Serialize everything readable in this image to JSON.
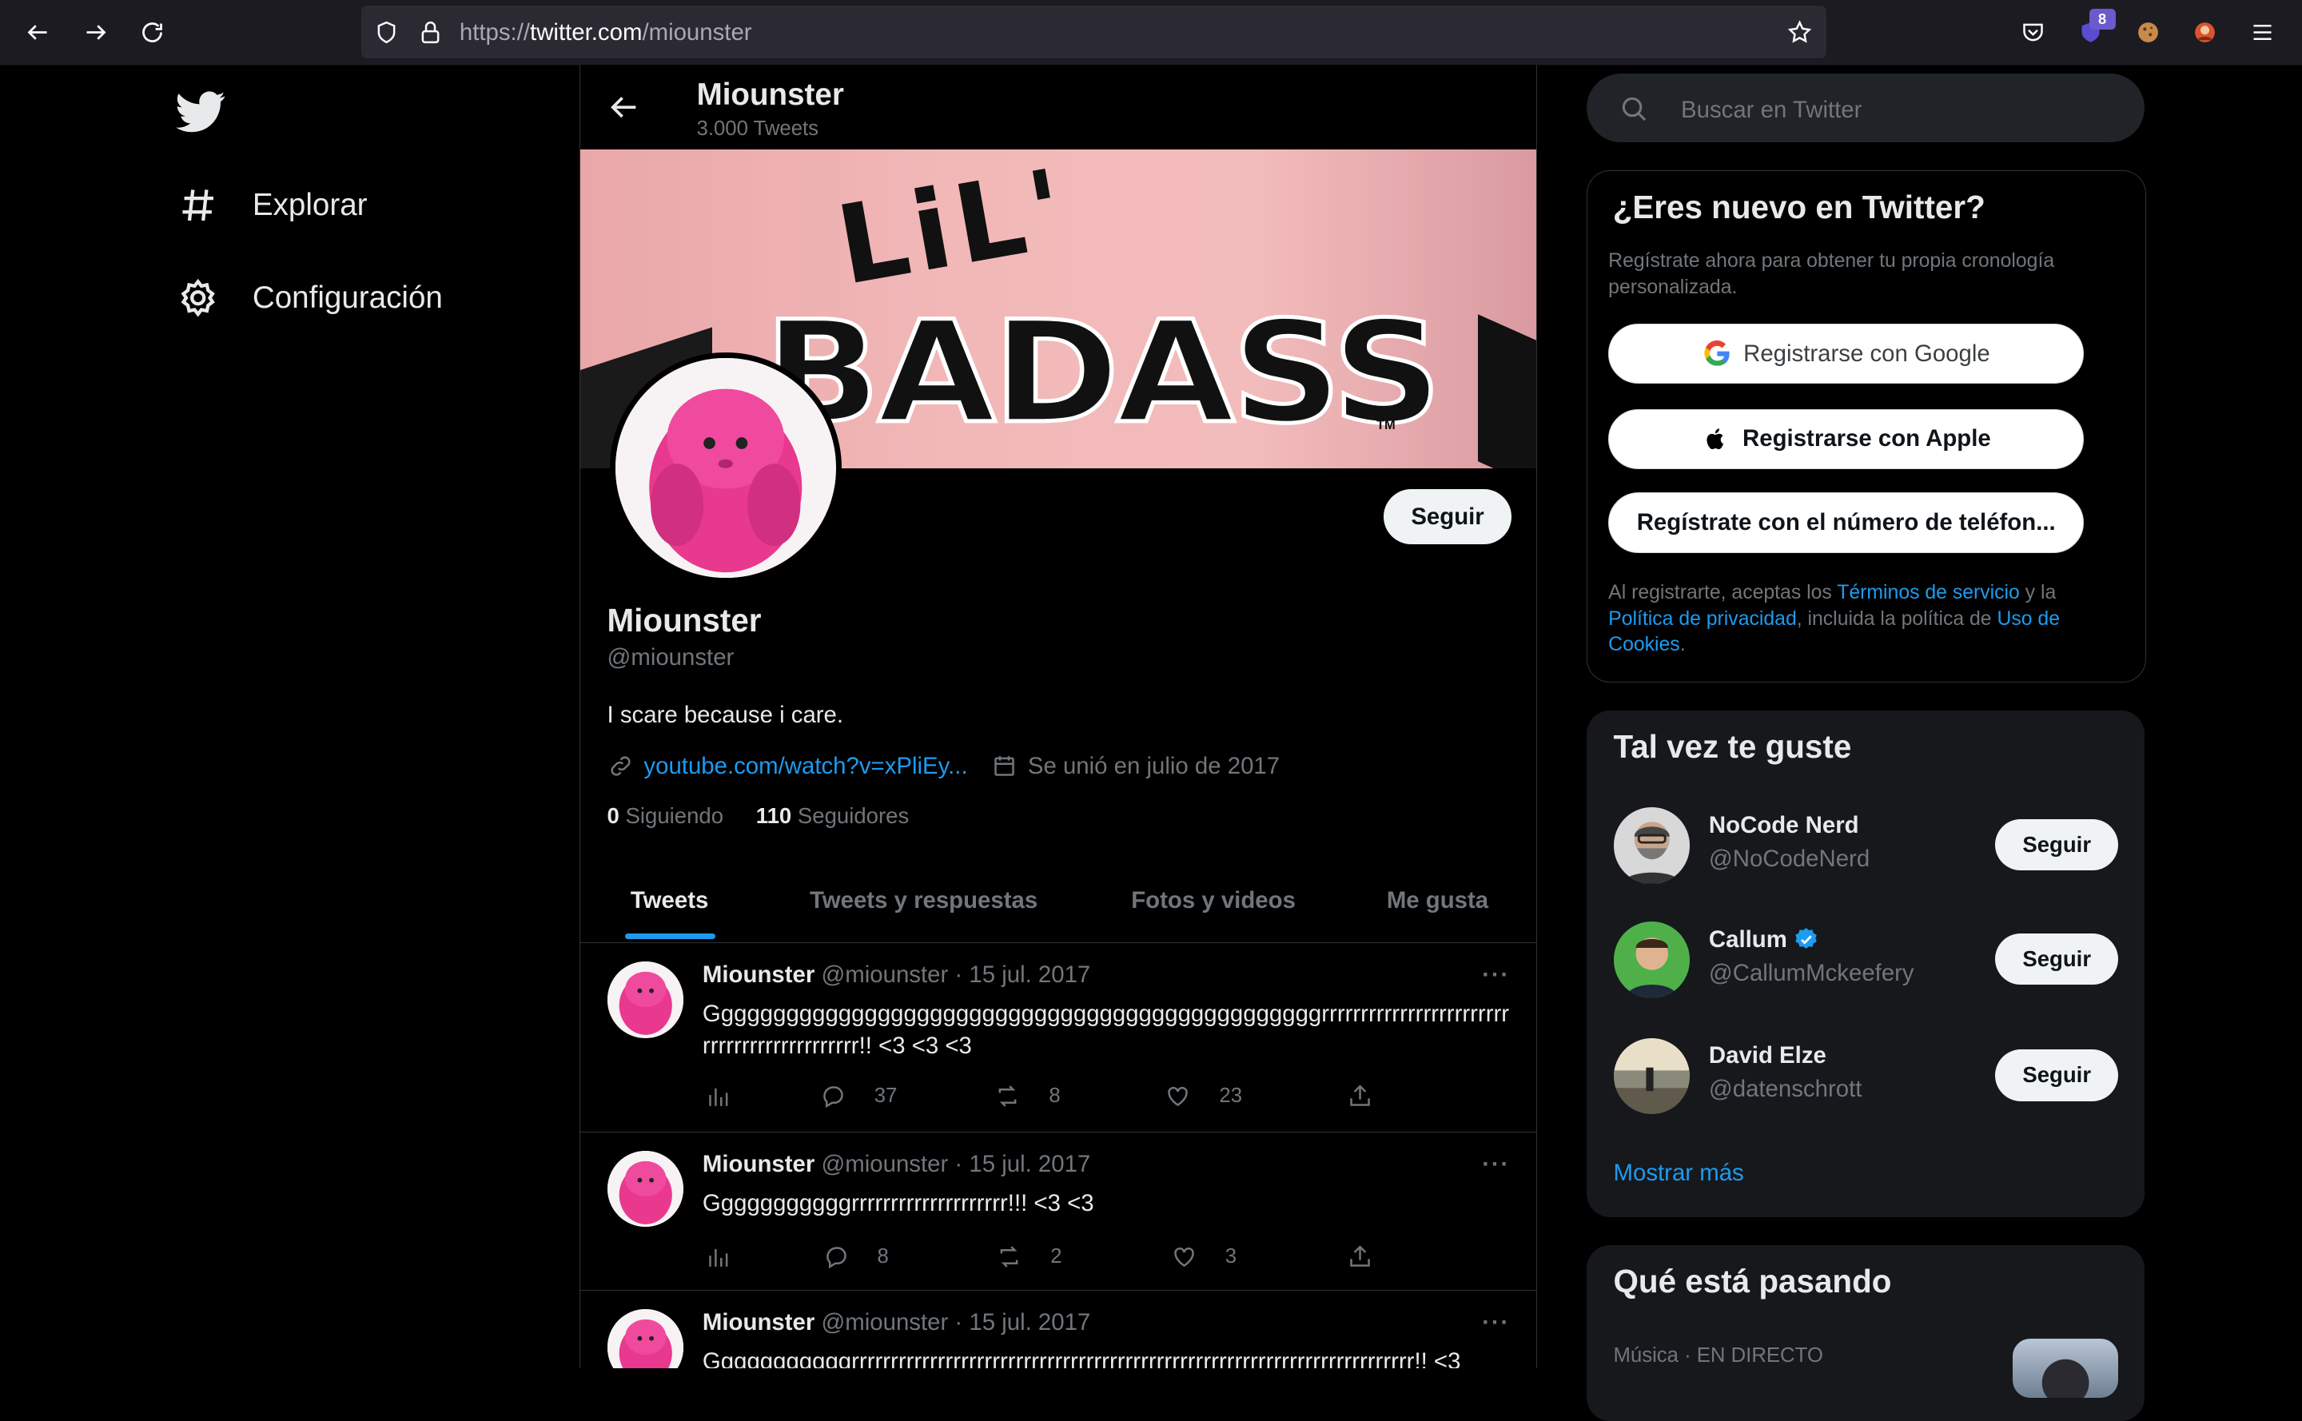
{
  "browser": {
    "url_prefix": "https://",
    "url_domain": "twitter.com",
    "url_path": "/miounster",
    "extension_badge": "8"
  },
  "left_nav": {
    "items": [
      {
        "label": "Explorar",
        "icon": "hashtag-icon"
      },
      {
        "label": "Configuración",
        "icon": "gear-icon"
      }
    ]
  },
  "header": {
    "name": "Miounster",
    "tweet_count": "3.000 Tweets"
  },
  "banner": {
    "line1": "LiL'",
    "line2": "BADASS",
    "tm": "TM"
  },
  "profile": {
    "follow_label": "Seguir",
    "name": "Miounster",
    "handle": "@miounster",
    "bio": "I scare because i care.",
    "link": "youtube.com/watch?v=xPliEy...",
    "joined": "Se unió en julio de 2017",
    "following_count": "0",
    "following_label": "Siguiendo",
    "followers_count": "110",
    "followers_label": "Seguidores"
  },
  "tabs": [
    "Tweets",
    "Tweets y respuestas",
    "Fotos y videos",
    "Me gusta"
  ],
  "tweets": [
    {
      "name": "Miounster",
      "handle": "@miounster",
      "date": "· 15 jul. 2017",
      "text": "Gggggggggggggggggggggggggggggggggggggggggggggggrrrrrrrrrrrrrrrrrrrrrrrrrrrrrrrrrrrrrrrrrrrr!! <3 <3 <3",
      "replies": "37",
      "retweets": "8",
      "likes": "23"
    },
    {
      "name": "Miounster",
      "handle": "@miounster",
      "date": "· 15 jul. 2017",
      "text": "Gggggggggggrrrrrrrrrrrrrrrrrrrr!!! <3 <3",
      "replies": "8",
      "retweets": "2",
      "likes": "3"
    },
    {
      "name": "Miounster",
      "handle": "@miounster",
      "date": "· 15 jul. 2017",
      "text": "Gggggggggggrrrrrrrrrrrrrrrrrrrrrrrrrrrrrrrrrrrrrrrrrrrrrrrrrrrrrrrrrrrrrrrrrrrrrrrr!! <3",
      "replies": "",
      "retweets": "",
      "likes": ""
    }
  ],
  "search": {
    "placeholder": "Buscar en Twitter"
  },
  "signup": {
    "title": "¿Eres nuevo en Twitter?",
    "subtitle": "Regístrate ahora para obtener tu propia cronología personalizada.",
    "google_label": "Registrarse con Google",
    "apple_label": "Registrarse con Apple",
    "phone_label": "Regístrate con el número de teléfon...",
    "legal_1": "Al registrarte, aceptas los ",
    "legal_terms": "Términos de servicio",
    "legal_2": " y la ",
    "legal_privacy": "Política de privacidad",
    "legal_3": ", incluida la política de ",
    "legal_cookies": "Uso de Cookies",
    "legal_4": "."
  },
  "suggestions": {
    "title": "Tal vez te guste",
    "follow_label": "Seguir",
    "items": [
      {
        "name": "NoCode Nerd",
        "handle": "@NoCodeNerd",
        "verified": false
      },
      {
        "name": "Callum",
        "handle": "@CallumMckeefery",
        "verified": true
      },
      {
        "name": "David Elze",
        "handle": "@datenschrott",
        "verified": false
      }
    ],
    "show_more": "Mostrar más"
  },
  "trends": {
    "title": "Qué está pasando",
    "meta": "Música · EN DIRECTO"
  },
  "colors": {
    "accent": "#1d9bf0",
    "background": "#000000",
    "secondary_text": "#71767b",
    "border": "#2f3336"
  }
}
